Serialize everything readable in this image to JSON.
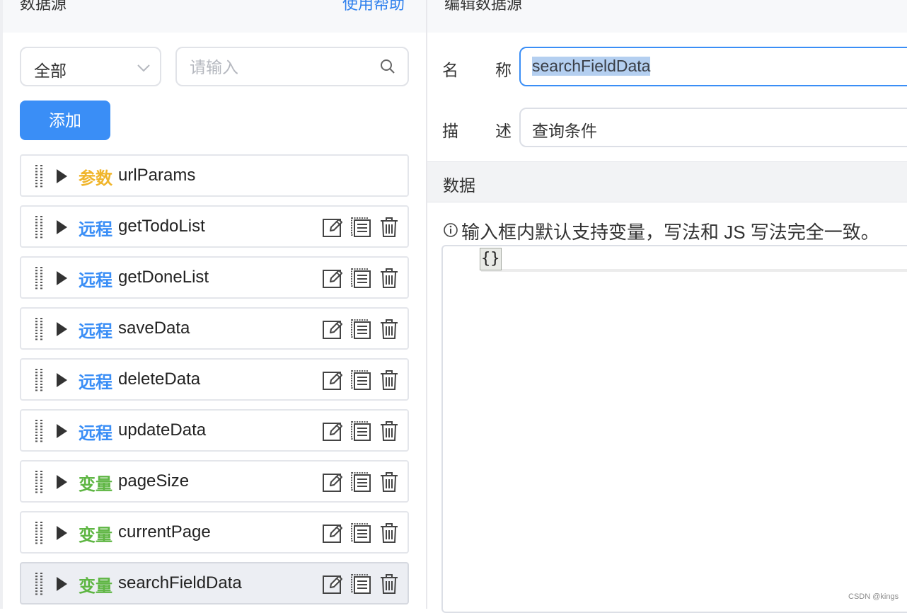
{
  "left_panel": {
    "title": "数据源",
    "help_link": "使用帮助",
    "filter_select": {
      "value": "全部"
    },
    "search": {
      "placeholder": "请输入",
      "value": ""
    },
    "add_button": "添加",
    "items": [
      {
        "tag": "参数",
        "tag_color": "#f0b52b",
        "name": "urlParams",
        "has_actions": false,
        "active": false
      },
      {
        "tag": "远程",
        "tag_color": "#3a8ef6",
        "name": "getTodoList",
        "has_actions": true,
        "active": false
      },
      {
        "tag": "远程",
        "tag_color": "#3a8ef6",
        "name": "getDoneList",
        "has_actions": true,
        "active": false
      },
      {
        "tag": "远程",
        "tag_color": "#3a8ef6",
        "name": "saveData",
        "has_actions": true,
        "active": false
      },
      {
        "tag": "远程",
        "tag_color": "#3a8ef6",
        "name": "deleteData",
        "has_actions": true,
        "active": false
      },
      {
        "tag": "远程",
        "tag_color": "#3a8ef6",
        "name": "updateData",
        "has_actions": true,
        "active": false
      },
      {
        "tag": "变量",
        "tag_color": "#5fb644",
        "name": "pageSize",
        "has_actions": true,
        "active": false
      },
      {
        "tag": "变量",
        "tag_color": "#5fb644",
        "name": "currentPage",
        "has_actions": true,
        "active": false
      },
      {
        "tag": "变量",
        "tag_color": "#5fb644",
        "name": "searchFieldData",
        "has_actions": true,
        "active": true
      }
    ],
    "item_icons": [
      "drag-handle-icon",
      "caret-right-icon",
      "edit-icon",
      "copy-icon",
      "delete-icon"
    ]
  },
  "right_panel": {
    "title": "编辑数据源",
    "name_label_1": "名",
    "name_label_2": "称",
    "name_value": "searchFieldData",
    "desc_label_1": "描",
    "desc_label_2": "述",
    "desc_value": "查询条件",
    "section_title": "数据",
    "tip_icon": "info-circle-icon",
    "tip_text": "输入框内默认支持变量，写法和 JS 写法完全一致。",
    "editor_code": "{}"
  },
  "watermark": "CSDN @kings",
  "colors": {
    "accent": "#3a8ef6",
    "param": "#f0b52b",
    "remote": "#3a8ef6",
    "variable": "#5fb644"
  }
}
